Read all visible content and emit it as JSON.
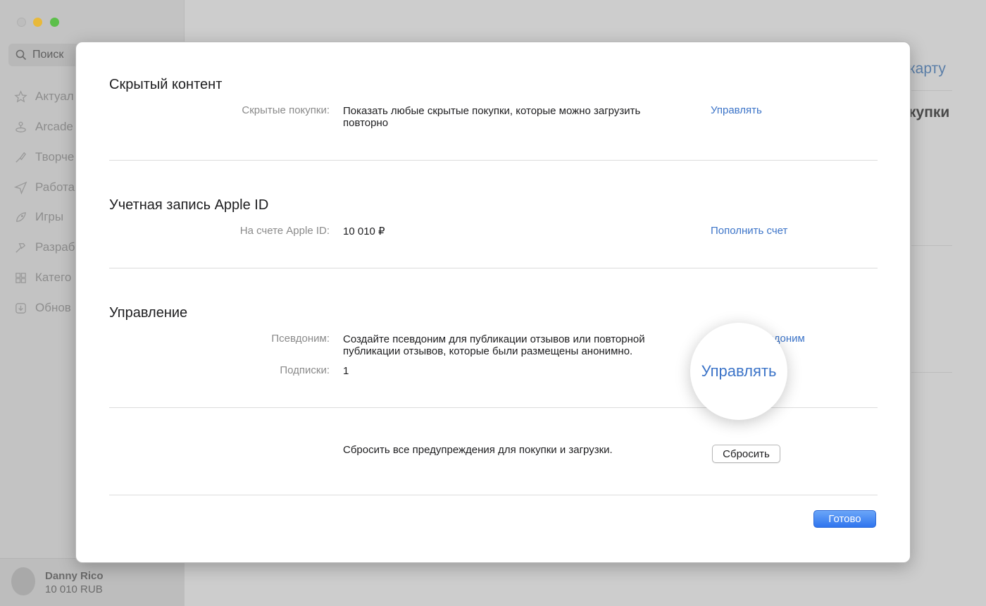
{
  "background_app": {
    "search_label": "Поиск",
    "sidebar_items": [
      {
        "icon": "star-icon",
        "label": "Актуал"
      },
      {
        "icon": "joystick-icon",
        "label": "Arcade"
      },
      {
        "icon": "brush-icon",
        "label": "Творче"
      },
      {
        "icon": "paper-plane-icon",
        "label": "Работа"
      },
      {
        "icon": "rocket-icon",
        "label": "Игры"
      },
      {
        "icon": "hammer-icon",
        "label": "Разраб"
      },
      {
        "icon": "grid-icon",
        "label": "Катего"
      },
      {
        "icon": "download-icon",
        "label": "Обнов"
      }
    ],
    "account": {
      "name": "Danny Rico",
      "balance": "10 010 RUB"
    },
    "right_link": "карту",
    "right_heading": "купки"
  },
  "modal": {
    "hidden": {
      "title": "Скрытый контент",
      "label": "Скрытые покупки:",
      "value": "Показать любые скрытые покупки, которые можно загрузить повторно",
      "link": "Управлять"
    },
    "apple_id": {
      "title": "Учетная запись Apple ID",
      "label": "На счете Apple ID:",
      "value": "10 010 ₽",
      "link": "Пополнить счет"
    },
    "manage": {
      "title": "Управление",
      "nickname_label": "Псевдоним:",
      "nickname_value": "Создайте псевдоним для публикации отзывов или повторной публикации отзывов, которые были размещены анонимно.",
      "nickname_link_partial": "вдоним",
      "subscriptions_label": "Подписки:",
      "subscriptions_value": "1",
      "magnified_link": "Управлять"
    },
    "reset": {
      "text": "Сбросить все предупреждения для покупки и загрузки.",
      "button": "Сбросить"
    },
    "done_button": "Готово"
  },
  "colors": {
    "link": "#3c74c8",
    "primary_button": "#2f75ee",
    "traffic_min": "#e8b93a",
    "traffic_max": "#5cbf4a"
  }
}
